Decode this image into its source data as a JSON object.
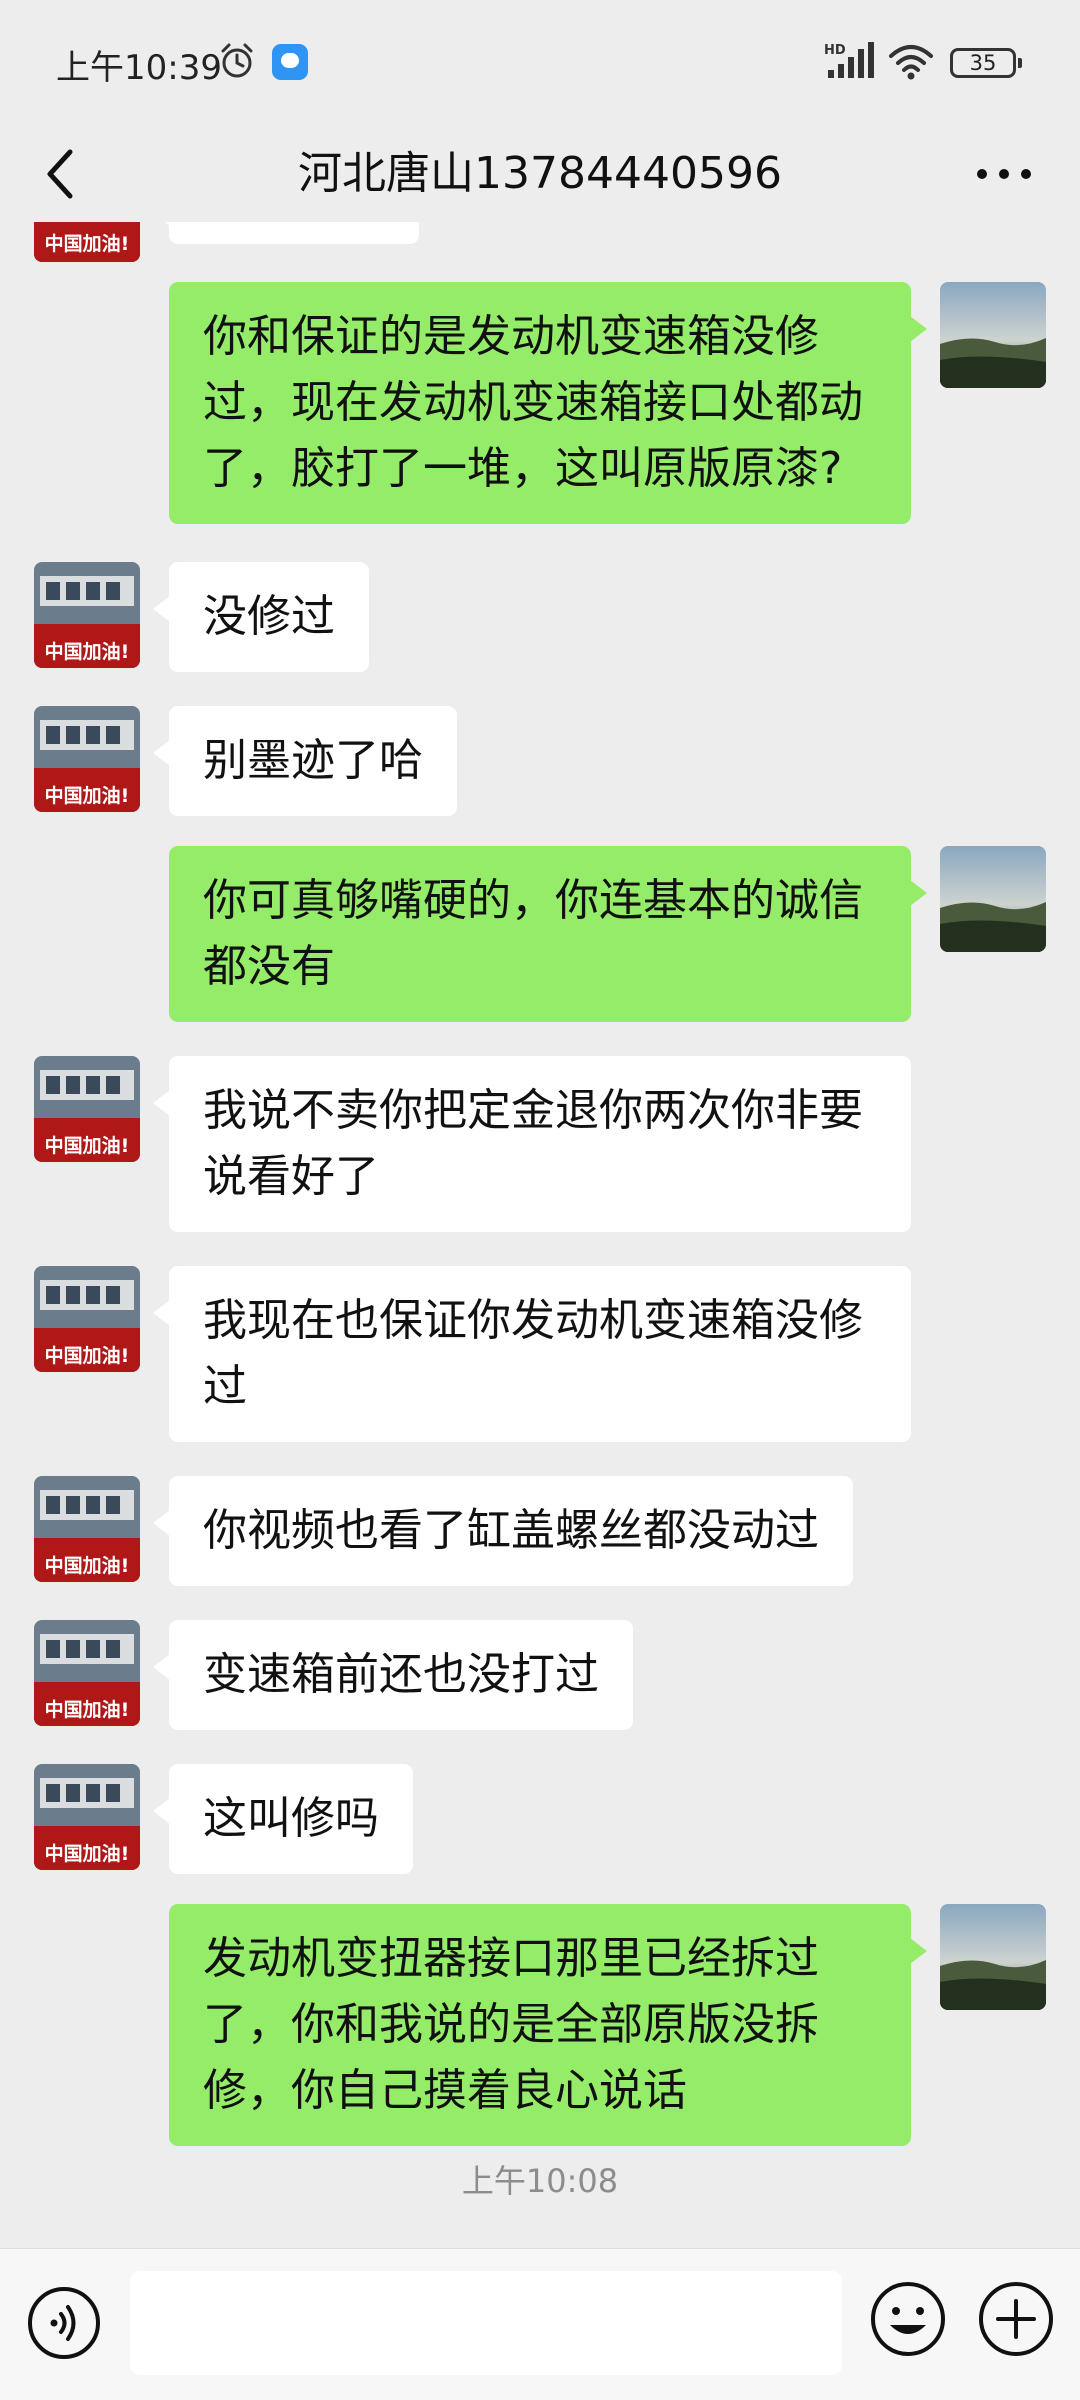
{
  "status_bar": {
    "time": "上午10:39",
    "network": "HD",
    "battery": "35",
    "icons": [
      "alarm-icon",
      "app-notification-icon",
      "signal-icon",
      "wifi-icon",
      "battery-icon"
    ]
  },
  "header": {
    "title": "河北唐山13784440596",
    "back_icon": "chevron-left-icon",
    "more_icon": "more-dots-icon"
  },
  "messages": [
    {
      "sender": "me",
      "text": "你和保证的是发动机变速箱没修过，现在发动机变速箱接口处都动了，胶打了一堆，这叫原版原漆?"
    },
    {
      "sender": "them",
      "text": "没修过"
    },
    {
      "sender": "them",
      "text": "别墨迹了哈"
    },
    {
      "sender": "me",
      "text": "你可真够嘴硬的，你连基本的诚信都没有"
    },
    {
      "sender": "them",
      "text": "我说不卖你把定金退你两次你非要说看好了"
    },
    {
      "sender": "them",
      "text": "我现在也保证你发动机变速箱没修过"
    },
    {
      "sender": "them",
      "text": "你视频也看了缸盖螺丝都没动过"
    },
    {
      "sender": "them",
      "text": "变速箱前还也没打过"
    },
    {
      "sender": "them",
      "text": "这叫修吗"
    },
    {
      "sender": "me",
      "text": "发动机变扭器接口那里已经拆过了，你和我说的是全部原版没拆修，你自己摸着良心说话"
    }
  ],
  "avatar_caption": "中国加油!",
  "time_divider": "上午10:08",
  "input_bar": {
    "placeholder": "",
    "icons": [
      "voice-icon",
      "emoji-icon",
      "plus-icon"
    ]
  },
  "colors": {
    "background": "#ededed",
    "my_bubble": "#95ec69",
    "their_bubble": "#ffffff"
  }
}
